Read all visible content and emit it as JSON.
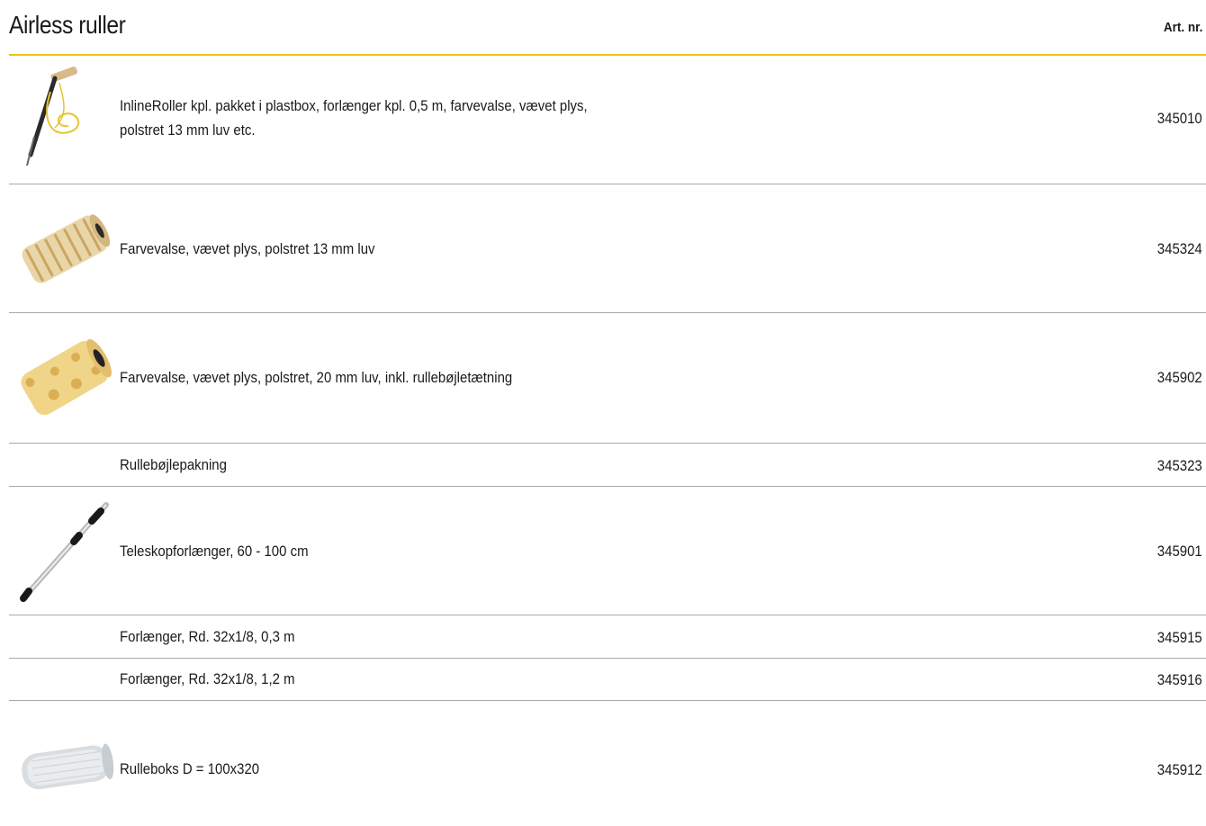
{
  "header": {
    "title": "Airless ruller",
    "art_nr_label": "Art. nr."
  },
  "colors": {
    "accent_rule": "#f0c419",
    "divider": "#a8a8a8"
  },
  "items": [
    {
      "desc_line1": "InlineRoller kpl. pakket i plastbox, forlænger kpl. 0,5 m, farvevalse, vævet plys,",
      "desc_line2": "polstret 13 mm luv etc.",
      "code": "345010",
      "icon": "inline-roller-kit-image"
    },
    {
      "desc": "Farvevalse, vævet plys, polstret 13 mm luv",
      "code": "345324",
      "icon": "roller-sleeve-13mm-image"
    },
    {
      "desc": "Farvevalse, vævet plys, polstret, 20 mm luv, inkl. rullebøjletætning",
      "code": "345902",
      "icon": "roller-sleeve-20mm-image"
    },
    {
      "desc": "Rullebøjlepakning",
      "code": "345323"
    },
    {
      "desc": "Teleskopforlænger, 60 - 100 cm",
      "code": "345901",
      "icon": "telescopic-extension-image"
    },
    {
      "desc": "Forlænger, Rd. 32x1/8, 0,3 m",
      "code": "345915"
    },
    {
      "desc": "Forlænger, Rd. 32x1/8, 1,2 m",
      "code": "345916"
    },
    {
      "desc": "Rulleboks D = 100x320",
      "code": "345912",
      "icon": "roller-box-image"
    }
  ]
}
